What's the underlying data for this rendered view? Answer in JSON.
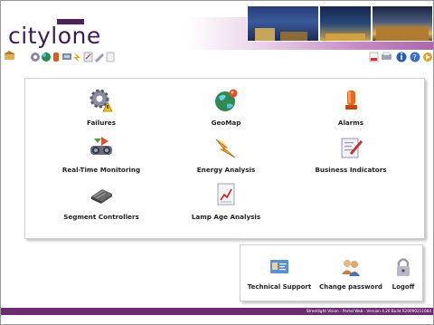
{
  "header": {
    "logo_text": "citylone"
  },
  "toolbar": {
    "icons": [
      "home-icon",
      "gear-icon",
      "globe-icon",
      "alarm-icon",
      "monitor-icon",
      "energy-icon",
      "report-icon",
      "pen-icon",
      "document-icon",
      "pdf-icon",
      "print-icon",
      "info-icon",
      "help-icon",
      "exit-icon"
    ]
  },
  "main": {
    "tiles": [
      {
        "label": "Failures",
        "icon": "gear-warning-icon"
      },
      {
        "label": "GeoMap",
        "icon": "globe-icon"
      },
      {
        "label": "Alarms",
        "icon": "alarm-icon"
      },
      {
        "label": "Real-Time Monitoring",
        "icon": "monitoring-icon"
      },
      {
        "label": "Energy Analysis",
        "icon": "energy-icon"
      },
      {
        "label": "Business Indicators",
        "icon": "business-indicators-icon"
      },
      {
        "label": "Segment Controllers",
        "icon": "segment-controller-icon"
      },
      {
        "label": "Lamp Age Analysis",
        "icon": "lamp-age-chart-icon"
      }
    ]
  },
  "account": {
    "items": [
      {
        "label": "Technical Support",
        "icon": "support-card-icon"
      },
      {
        "label": "Change password",
        "icon": "users-icon"
      },
      {
        "label": "Logoff",
        "icon": "padlock-icon"
      }
    ]
  },
  "footer": {
    "text": "Streetlight.Vision - Portal Web - Version 4.20 Build R20090211084"
  },
  "colors": {
    "brand": "#4a2458",
    "footer": "#6a2d70",
    "banner_gradient_end": "#a96aa8"
  }
}
